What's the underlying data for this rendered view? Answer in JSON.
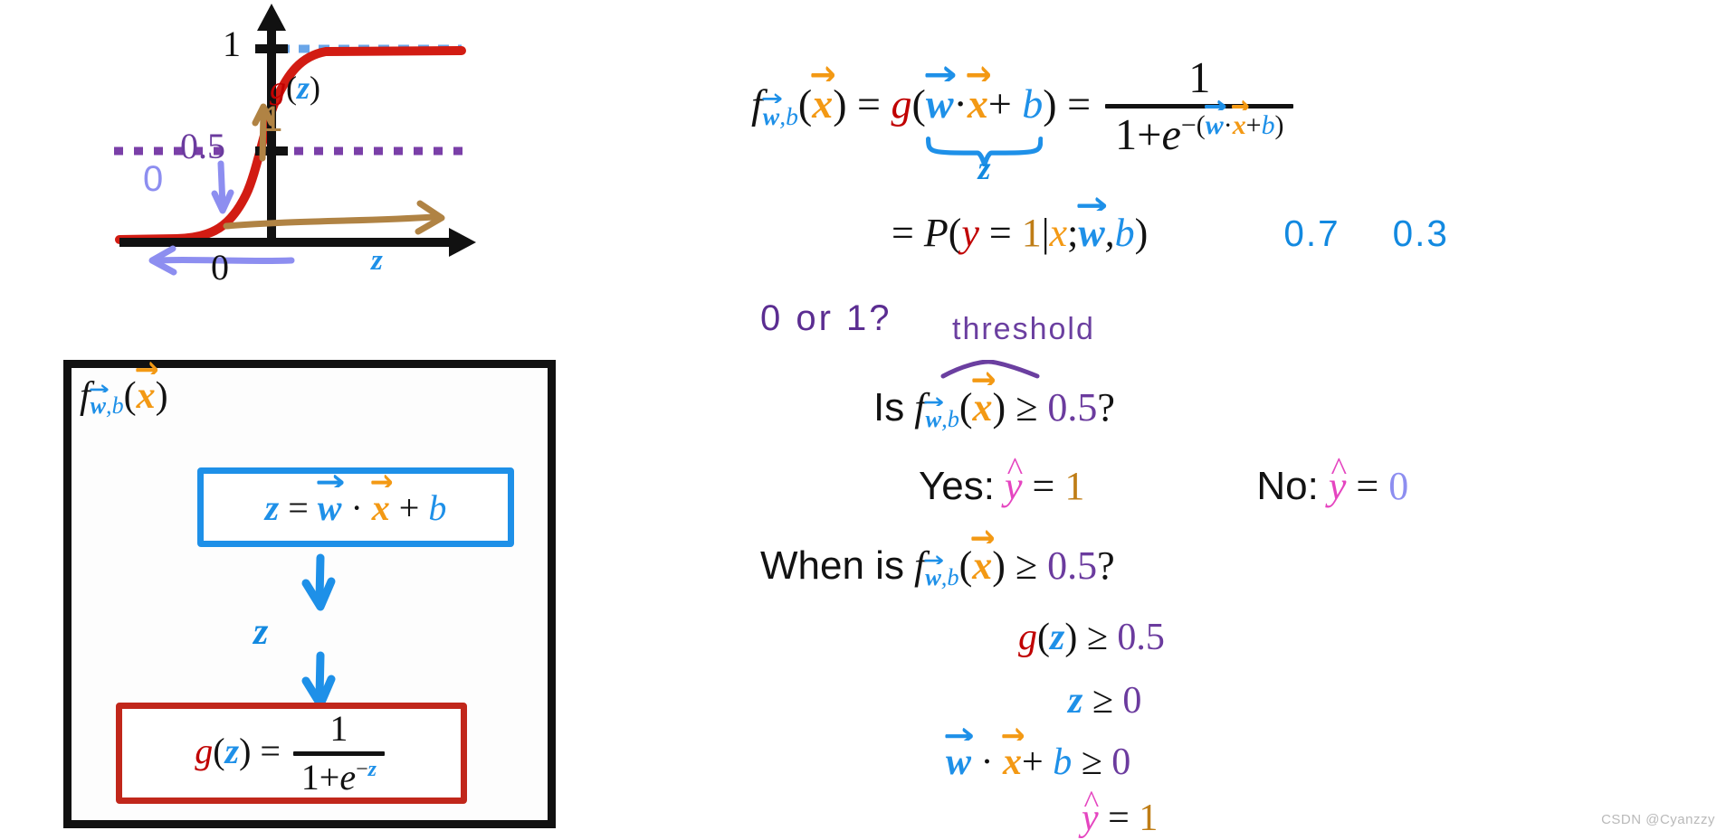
{
  "plot": {
    "y_tick_one": "1",
    "y_tick_half": "0.5",
    "x_tick_zero": "0",
    "x_axis_label": "z",
    "curve_label_g": "g",
    "curve_label_paren_open": "(",
    "curve_label_z": "z",
    "curve_label_paren_close": ")",
    "annotation_up_one": "1",
    "annotation_up_arrow": "↑",
    "annotation_down_zero": "0",
    "annotation_down_arrow": "↓",
    "curve_color": "#d21c13",
    "dashed_one_color": "#6aa6e8",
    "dashed_half_color": "#7a3fa8",
    "axis_color": "#111111",
    "brown_arrow_color": "#b08344",
    "peri_arrow_color": "#8d8ef0"
  },
  "diagram": {
    "title": {
      "f": "f",
      "w": "w",
      "comma": ",",
      "b": "b",
      "paren_open": "(",
      "x": "x",
      "paren_close": ")"
    },
    "blue_box": {
      "z": "z",
      "eq": "=",
      "w": "w",
      "dot": "·",
      "x": "x",
      "plus": "+",
      "b": "b"
    },
    "red_box": {
      "g": "g",
      "paren_open": "(",
      "z": "z",
      "paren_close": ")",
      "eq": "=",
      "num": "1",
      "den_one": "1+",
      "den_e": "e",
      "den_exp_minus": "−",
      "den_exp_z": "z"
    },
    "arrow_label_z": "z",
    "frame_color": "#111111",
    "blue_box_color": "#1e90e8",
    "red_box_color": "#c1271b",
    "arrow_color": "#1e90e8"
  },
  "equations": {
    "main": {
      "f": "f",
      "w": "w",
      "comma": ",",
      "b": "b",
      "paren_open": "(",
      "x": "x",
      "paren_close": ")",
      "eq1": "=",
      "g": "g",
      "g_paren_open": "(",
      "w2": "w",
      "dot": "·",
      "x2": "x",
      "plus": "+",
      "b2": "b",
      "g_paren_close": ")",
      "eq2": "=",
      "frac_num": "1",
      "frac_den_one": "1",
      "frac_den_plus": "+",
      "frac_den_e": "e",
      "exp_minus": "−",
      "exp_paren_open": "(",
      "exp_w": "w",
      "exp_dot": "·",
      "exp_x": "x",
      "exp_plus": "+",
      "exp_b": "b",
      "exp_paren_close": ")",
      "underbrace_label": "z"
    },
    "probability": {
      "eq": "=",
      "P": "P",
      "paren_open": "(",
      "y": "y",
      "equals": "=",
      "one": "1",
      "bar": "|",
      "x": "x",
      "semicolon": ";",
      "w": "w",
      "comma": ",",
      "b": "b",
      "paren_close": ")",
      "value_high": "0.7",
      "value_low": "0.3"
    },
    "annotations": {
      "zero_or_one": "0 or 1?",
      "threshold": "threshold"
    },
    "is_line": {
      "is": "Is",
      "f": "f",
      "w": "w",
      "comma": ",",
      "b": "b",
      "paren_open": "(",
      "x": "x",
      "paren_close": ")",
      "geq": "≥",
      "value": "0.5",
      "question": "?"
    },
    "yes_no": {
      "yes_label": "Yes:",
      "yes_yhat": "y",
      "yes_hat": "̂",
      "yes_eq": "=",
      "yes_value": "1",
      "no_label": "No:",
      "no_yhat": "y",
      "no_eq": "=",
      "no_value": "0"
    },
    "when_line": {
      "when_is": "When is",
      "f": "f",
      "w": "w",
      "comma": ",",
      "b": "b",
      "paren_open": "(",
      "x": "x",
      "paren_close": ")",
      "geq": "≥",
      "value": "0.5",
      "question": "?"
    },
    "gz_line": {
      "g": "g",
      "paren_open": "(",
      "z": "z",
      "paren_close": ")",
      "geq": "≥",
      "value": "0.5"
    },
    "z_line": {
      "z": "z",
      "geq": "≥",
      "value": "0"
    },
    "wxb_line": {
      "w": "w",
      "dot": "·",
      "x": "x",
      "plus": "+",
      "b": "b",
      "geq": "≥",
      "value": "0"
    },
    "yhat_line": {
      "yhat": "y",
      "eq": "=",
      "value": "1"
    }
  },
  "colors": {
    "blue": "#1e90e8",
    "orange": "#f39914",
    "red": "#c00000",
    "purple": "#6b3b9e",
    "magenta": "#e545c0",
    "gold": "#bf7d16",
    "periwinkle": "#8d8ef0",
    "brown": "#b08344"
  },
  "watermark": "CSDN @Cyanzzy"
}
